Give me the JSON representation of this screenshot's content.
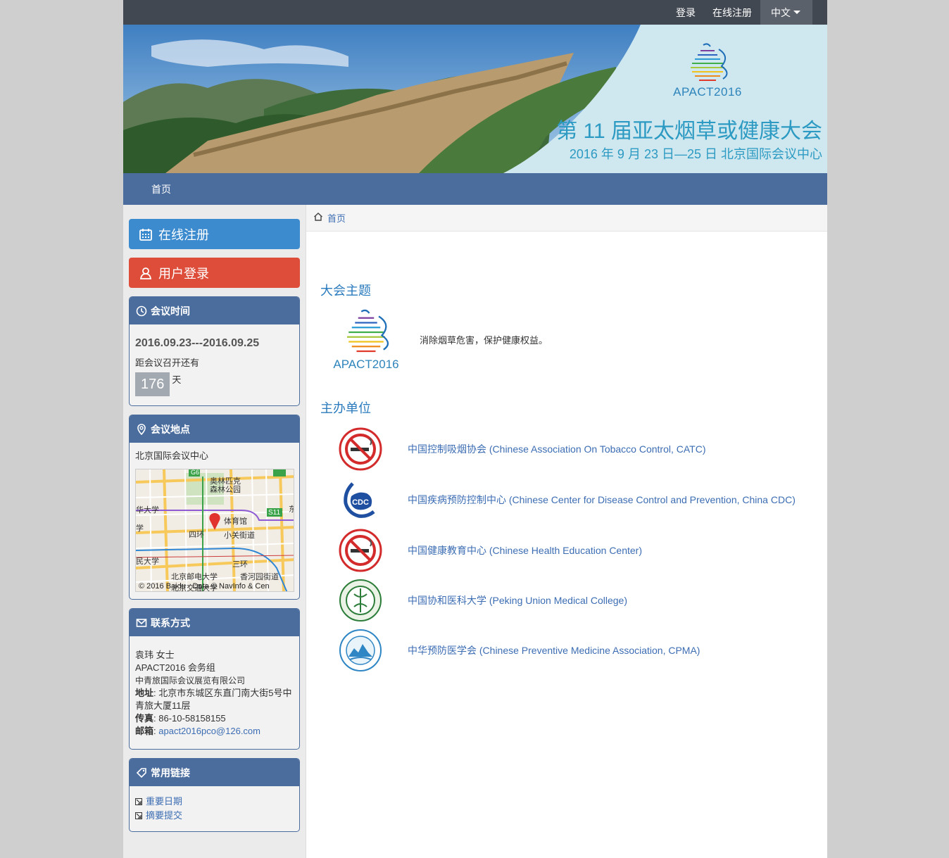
{
  "topbar": {
    "login": "登录",
    "register": "在线注册",
    "language": "中文"
  },
  "banner": {
    "logo_text": "APACT2016",
    "title": "第 11 届亚太烟草或健康大会",
    "subtitle": "2016 年 9 月 23 日—25 日 北京国际会议中心"
  },
  "nav": {
    "home": "首页"
  },
  "sidebar": {
    "register_button": "在线注册",
    "login_button": "用户登录",
    "time_panel": {
      "title": "会议时间",
      "dates": "2016.09.23---2016.09.25",
      "countdown_label": "距会议召开还有",
      "days": "176",
      "unit": "天"
    },
    "location_panel": {
      "title": "会议地点",
      "venue": "北京国际会议中心",
      "map_labels": [
        "奥林匹克",
        "森林公园",
        "华大学",
        "体育馆",
        "小关街道",
        "四环",
        "S11",
        "三环",
        "民大学",
        "北京邮电大学",
        "香河园街道",
        "北京交通大学",
        "东",
        "学",
        "G6"
      ],
      "map_copyright": "© 2016 Baidu - Data © NavInfo & Cen"
    },
    "contact_panel": {
      "title": "联系方式",
      "name": "袁玮 女士",
      "group": "APACT2016 会务组",
      "company": "中青旅国际会议展览有限公司",
      "address_label": "地址",
      "address": ": 北京市东城区东直门南大街5号中青旅大厦11层",
      "fax_label": "传真",
      "fax": ": 86-10-58158155",
      "email_label": "邮箱",
      "email_sep": ": ",
      "email": "apact2016pco@126.com"
    },
    "links_panel": {
      "title": "常用链接",
      "items": [
        "重要日期",
        "摘要提交"
      ]
    }
  },
  "main": {
    "breadcrumb": "首页",
    "theme_title": "大会主题",
    "theme_logo_text": "APACT2016",
    "theme_text": "消除烟草危害，保护健康权益。",
    "organizers_title": "主办单位",
    "organizers": [
      {
        "name": "中国控制吸烟协会 (Chinese Association On Tobacco Control, CATC)",
        "logo": "no-smoking-icon"
      },
      {
        "name": "中国疾病预防控制中心 (Chinese Center for Disease Control and Prevention, China CDC)",
        "logo": "cdc-logo-icon"
      },
      {
        "name": "中国健康教育中心 (Chinese Health Education Center)",
        "logo": "no-smoking-icon"
      },
      {
        "name": "中国协和医科大学 (Peking Union Medical College)",
        "logo": "pumc-seal-icon"
      },
      {
        "name": "中华预防医学会 (Chinese Preventive Medicine Association, CPMA)",
        "logo": "cpma-seal-icon"
      }
    ]
  },
  "colors": {
    "nav": "#4b6d9e",
    "register": "#3d8bcf",
    "login": "#dd4d3a",
    "link": "#3c6db3",
    "heading": "#2a7bbd"
  }
}
